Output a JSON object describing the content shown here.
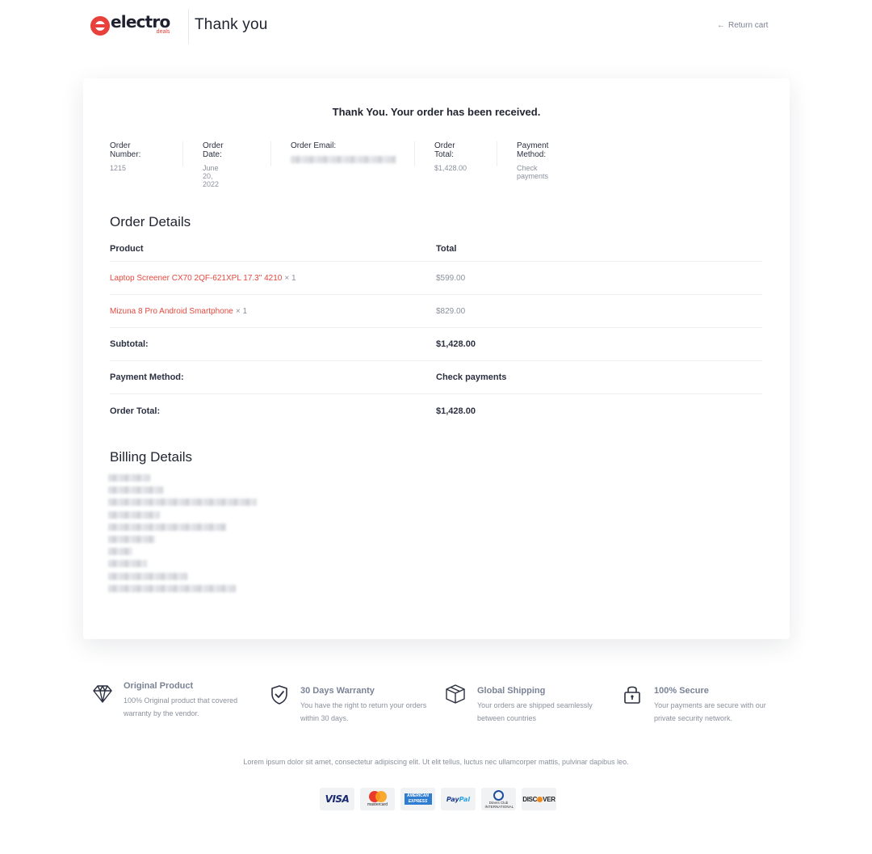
{
  "header": {
    "logo_text": "electro",
    "logo_sub": "deals",
    "title": "Thank you",
    "return_label": "Return cart",
    "return_icon": "arrow-left-icon"
  },
  "confirmation": {
    "message": "Thank You. Your order has been received.",
    "overview": [
      {
        "label": "Order Number:",
        "value": "1215"
      },
      {
        "label": "Order Date:",
        "value": "June 20, 2022"
      },
      {
        "label": "Order Email:",
        "value": ""
      },
      {
        "label": "Order Total:",
        "value": "$1,428.00"
      },
      {
        "label": "Payment Method:",
        "value": "Check payments"
      }
    ]
  },
  "order_details": {
    "title": "Order Details",
    "columns": [
      "Product",
      "Total"
    ],
    "items": [
      {
        "name": "Laptop Screener CX70 2QF-621XPL 17.3\" 4210",
        "qty": "× 1",
        "total": "$599.00"
      },
      {
        "name": "Mizuna 8 Pro Android Smartphone",
        "qty": "× 1",
        "total": "$829.00"
      }
    ],
    "summary": [
      {
        "label": "Subtotal:",
        "value": "$1,428.00"
      },
      {
        "label": "Payment Method:",
        "value": "Check payments"
      },
      {
        "label": "Order Total:",
        "value": "$1,428.00"
      }
    ]
  },
  "billing": {
    "title": "Billing Details"
  },
  "features": [
    {
      "icon": "diamond-icon",
      "title": "Original Product",
      "text": "100% Original product that covered warranty by the vendor."
    },
    {
      "icon": "shield-check-icon",
      "title": "30 Days Warranty",
      "text": "You have the right to return your orders within 30 days."
    },
    {
      "icon": "box-icon",
      "title": "Global Shipping",
      "text": "Your orders are shipped seamlessly between countries"
    },
    {
      "icon": "lock-icon",
      "title": "100% Secure",
      "text": "Your payments are secure with our private security network."
    }
  ],
  "footer": {
    "text": "Lorem ipsum dolor sit amet, consectetur adipiscing elit. Ut elit tellus, luctus nec ullamcorper mattis, pulvinar dapibus leo.",
    "payments": {
      "visa": "VISA",
      "mastercard": "mastercard",
      "amex": "AMERICAN EXPRESS",
      "paypal_a": "Pay",
      "paypal_b": "Pal",
      "diners": "Diners Club INTERNATIONAL",
      "discover_a": "DISC",
      "discover_b": "VER"
    }
  },
  "colors": {
    "brand": "#e8403a",
    "product_link": "#e4493f",
    "text_dark": "#1f2430",
    "text_muted": "#8a909c"
  }
}
